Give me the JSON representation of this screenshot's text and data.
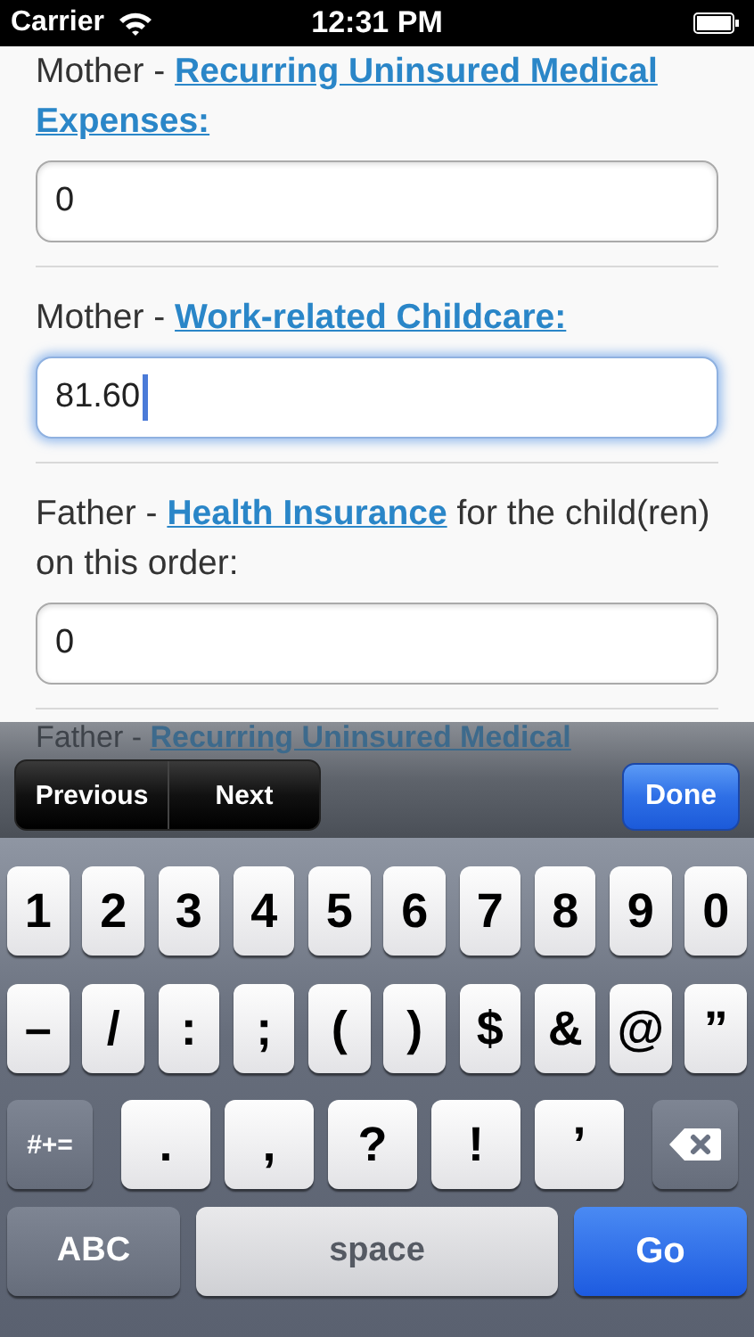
{
  "status_bar": {
    "carrier": "Carrier",
    "time": "12:31 PM"
  },
  "fields": [
    {
      "prefix": "Mother - ",
      "link": "Recurring Uninsured Medical Expenses:",
      "value": "0",
      "focused": false
    },
    {
      "prefix": "Mother - ",
      "link": "Work-related Childcare:",
      "value": "81.60",
      "focused": true
    },
    {
      "prefix": "Father - ",
      "link": "Health Insurance",
      "suffix": " for the child(ren) on this order:",
      "value": "0",
      "focused": false
    }
  ],
  "peek": {
    "prefix": "Father - ",
    "link": "Recurring Uninsured Medical"
  },
  "toolbar": {
    "previous": "Previous",
    "next": "Next",
    "done": "Done"
  },
  "keyboard": [
    [
      {
        "kind": "char",
        "label": "1"
      },
      {
        "kind": "char",
        "label": "2"
      },
      {
        "kind": "char",
        "label": "3"
      },
      {
        "kind": "char",
        "label": "4"
      },
      {
        "kind": "char",
        "label": "5"
      },
      {
        "kind": "char",
        "label": "6"
      },
      {
        "kind": "char",
        "label": "7"
      },
      {
        "kind": "char",
        "label": "8"
      },
      {
        "kind": "char",
        "label": "9"
      },
      {
        "kind": "char",
        "label": "0"
      }
    ],
    [
      {
        "kind": "char",
        "label": "–"
      },
      {
        "kind": "char",
        "label": "/"
      },
      {
        "kind": "char",
        "label": ":"
      },
      {
        "kind": "char",
        "label": ";"
      },
      {
        "kind": "char",
        "label": "("
      },
      {
        "kind": "char",
        "label": ")"
      },
      {
        "kind": "char",
        "label": "$"
      },
      {
        "kind": "char",
        "label": "&"
      },
      {
        "kind": "char",
        "label": "@"
      },
      {
        "kind": "char",
        "label": "”"
      }
    ],
    [
      {
        "kind": "mode",
        "label": "#+="
      },
      {
        "kind": "char",
        "label": "."
      },
      {
        "kind": "char",
        "label": ","
      },
      {
        "kind": "char",
        "label": "?"
      },
      {
        "kind": "char",
        "label": "!"
      },
      {
        "kind": "char",
        "label": "’"
      },
      {
        "kind": "delete"
      }
    ],
    [
      {
        "kind": "mode",
        "label": "ABC"
      },
      {
        "kind": "space",
        "label": "space"
      },
      {
        "kind": "go",
        "label": "Go"
      }
    ]
  ]
}
